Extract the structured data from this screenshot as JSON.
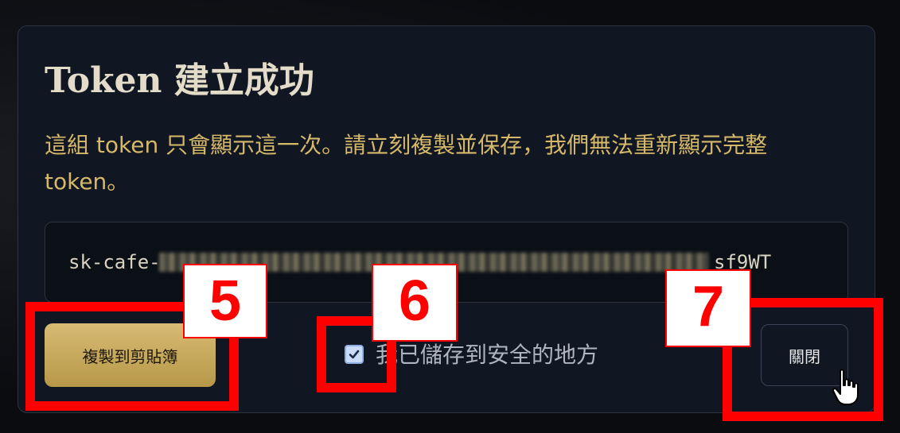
{
  "dialog": {
    "title": "Token 建立成功",
    "description": "這組 token 只會顯示這一次。請立刻複製並保存，我們無法重新顯示完整 token。",
    "token_prefix": "sk-cafe-",
    "token_suffix": "sf9WT",
    "copy_button": "複製到剪貼簿",
    "checkbox_label": "我已儲存到安全的地方",
    "checkbox_checked": true,
    "close_button": "關閉"
  },
  "annotations": [
    {
      "label": "5"
    },
    {
      "label": "6"
    },
    {
      "label": "7"
    }
  ],
  "colors": {
    "accent": "#d6b869",
    "highlight": "#ff0000",
    "dialog_bg": "#111722"
  }
}
